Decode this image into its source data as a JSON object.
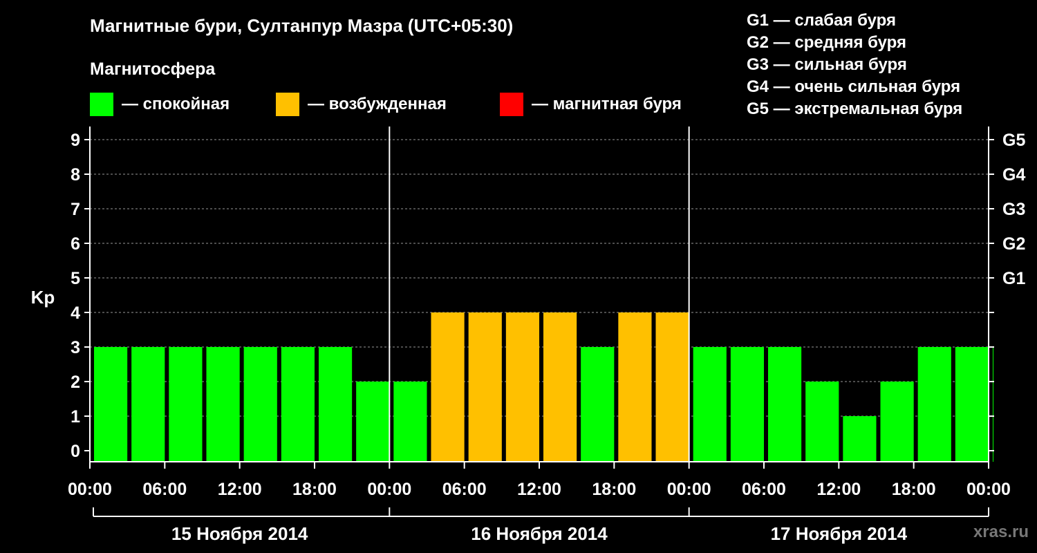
{
  "title": "Магнитные бури, Султанпур Мазра (UTC+05:30)",
  "subtitle": "Магнитосфера",
  "legend": [
    {
      "label": "— спокойная",
      "color": "#00ff00"
    },
    {
      "label": "— возбужденная",
      "color": "#ffc000"
    },
    {
      "label": "— магнитная буря",
      "color": "#ff0000"
    }
  ],
  "storm_levels": [
    "G1 — слабая буря",
    "G2 — средняя буря",
    "G3 — сильная буря",
    "G4 — очень сильная буря",
    "G5 — экстремальная буря"
  ],
  "watermark": "xras.ru",
  "chart_data": {
    "type": "bar",
    "ylabel": "Kp",
    "ylim": [
      0,
      9
    ],
    "yticks": [
      0,
      1,
      2,
      3,
      4,
      5,
      6,
      7,
      8,
      9
    ],
    "right_axis": [
      {
        "kp": 5,
        "label": "G1"
      },
      {
        "kp": 6,
        "label": "G2"
      },
      {
        "kp": 7,
        "label": "G3"
      },
      {
        "kp": 8,
        "label": "G4"
      },
      {
        "kp": 9,
        "label": "G5"
      }
    ],
    "x_tick_labels": [
      "00:00",
      "06:00",
      "12:00",
      "18:00",
      "00:00",
      "06:00",
      "12:00",
      "18:00",
      "00:00",
      "06:00",
      "12:00",
      "18:00",
      "00:00"
    ],
    "days": [
      "15 Ноября 2014",
      "16 Ноября 2014",
      "17 Ноября 2014"
    ],
    "grid": true,
    "values": [
      3,
      3,
      3,
      3,
      3,
      3,
      3,
      2,
      2,
      4,
      4,
      4,
      4,
      3,
      4,
      4,
      3,
      3,
      3,
      2,
      1,
      2,
      3,
      3,
      3
    ],
    "colors": {
      "quiet": "#00ff00",
      "active": "#ffc000",
      "storm": "#ff0000"
    }
  }
}
